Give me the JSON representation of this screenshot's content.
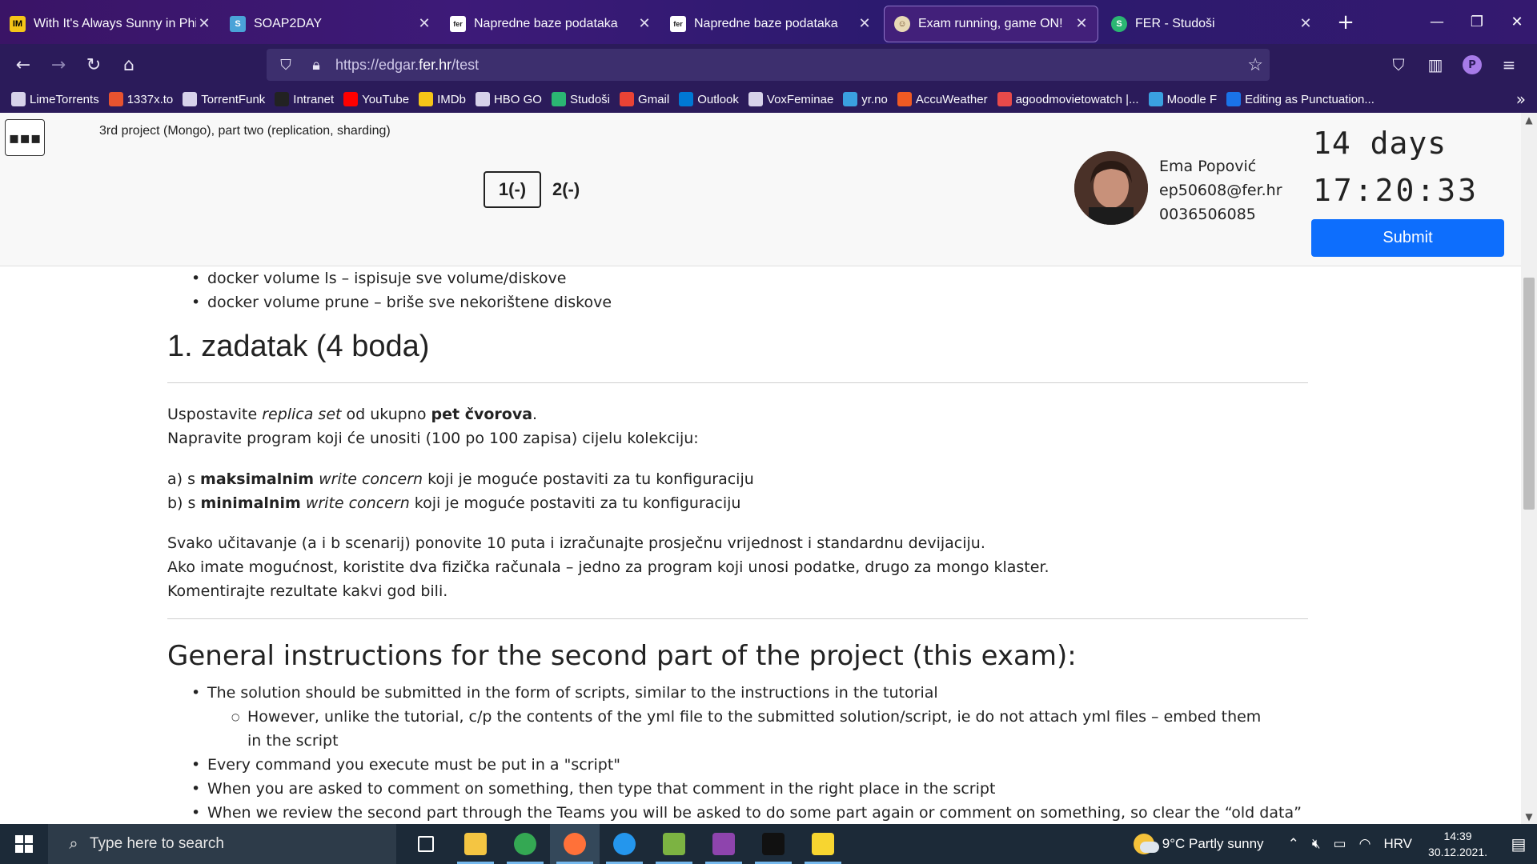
{
  "tabs": [
    {
      "title": "With It's Always Sunny in Philad",
      "favicon": "imdb-icon",
      "color": "#f5c518"
    },
    {
      "title": "SOAP2DAY",
      "favicon": "s-icon",
      "color": "#4aa3d8"
    },
    {
      "title": "Napredne baze podataka",
      "favicon": "fer-icon",
      "color": "#222222"
    },
    {
      "title": "Napredne baze podataka",
      "favicon": "fer-icon",
      "color": "#222222"
    },
    {
      "title": "Exam running, game ON!",
      "favicon": "edgar-icon",
      "color": "#e8d9b5",
      "active": true
    },
    {
      "title": "FER - Studoši",
      "favicon": "studosi-icon",
      "color": "#2bb673"
    }
  ],
  "url": {
    "prefix": "https://edgar.",
    "domain": "fer.hr",
    "path": "/test"
  },
  "bookmarks": [
    {
      "label": "LimeTorrents",
      "icon": "globe-icon",
      "color": "#d7d2ea"
    },
    {
      "label": "1337x.to",
      "icon": "x-icon",
      "color": "#e8532f"
    },
    {
      "label": "TorrentFunk",
      "icon": "torrentfunk-icon",
      "color": "#d7d2ea"
    },
    {
      "label": "Intranet",
      "icon": "fer-icon",
      "color": "#222222"
    },
    {
      "label": "YouTube",
      "icon": "youtube-icon",
      "color": "#ff0000"
    },
    {
      "label": "IMDb",
      "icon": "imdb-icon",
      "color": "#f5c518"
    },
    {
      "label": "HBO GO",
      "icon": "hbo-icon",
      "color": "#d7d2ea"
    },
    {
      "label": "Studoši",
      "icon": "studosi-icon",
      "color": "#2bb673"
    },
    {
      "label": "Gmail",
      "icon": "gmail-icon",
      "color": "#ea4335"
    },
    {
      "label": "Outlook",
      "icon": "outlook-icon",
      "color": "#0078d4"
    },
    {
      "label": "VoxFeminae",
      "icon": "globe-icon",
      "color": "#d7d2ea"
    },
    {
      "label": "yr.no",
      "icon": "yr-icon",
      "color": "#3aa0e0"
    },
    {
      "label": "AccuWeather",
      "icon": "accuweather-icon",
      "color": "#f05a23"
    },
    {
      "label": "agoodmovietowatch |...",
      "icon": "agoodmovie-icon",
      "color": "#e84a4a"
    },
    {
      "label": "Moodle F",
      "icon": "moodle-icon",
      "color": "#3aa0e0"
    },
    {
      "label": "Editing as Punctuation...",
      "icon": "v-icon",
      "color": "#1a73e8"
    }
  ],
  "header": {
    "exam_title": "3rd project (Mongo), part two (replication, sharding)",
    "questions": [
      "1(-)",
      "2(-)"
    ],
    "user": {
      "name": "Ema Popović",
      "email": "ep50608@fer.hr",
      "id": "0036506085"
    },
    "timer_days": "14 days",
    "timer_clock": "17:20:33",
    "submit_label": "Submit"
  },
  "content": {
    "top_items": [
      "docker volume ls – ispisuje sve volume/diskove",
      "docker volume prune – briše sve nekorištene diskove"
    ],
    "task_heading": "1. zadatak (4 boda)",
    "p1_a": "Uspostavite ",
    "p1_b": "replica set",
    "p1_c": " od ukupno ",
    "p1_d": "pet čvorova",
    "p1_e": ".",
    "p2": "Napravite program koji će unositi (100 po 100 zapisa) cijelu kolekciju:",
    "a_pre": "a) s ",
    "a_bold": "maksimalnim",
    "a_it": "write concern",
    "a_post": " koji je moguće postaviti za tu konfiguraciju",
    "b_pre": "b) s ",
    "b_bold": "minimalnim",
    "b_it": "write concern",
    "b_post": " koji je moguće postaviti za tu konfiguraciju",
    "p3": "Svako učitavanje (a i b scenarij) ponovite 10 puta i izračunajte prosječnu vrijednost i standardnu devijaciju.",
    "p4": "Ako imate mogućnost, koristite dva fizička računala – jedno za program koji unosi podatke, drugo za mongo klaster.",
    "p5": "Komentirajte rezultate kakvi god bili.",
    "general_heading": "General instructions for the second part of the project (this exam):",
    "gi1": "The solution should be submitted in the form of scripts, similar to the instructions in the tutorial",
    "gi1_sub": "However, unlike the tutorial, c/p the contents of the yml file to the submitted solution/script, ie do not attach yml files – embed them in the script",
    "gi2": "Every command you execute must be put in a \"script\"",
    "gi3": "When you are asked to comment on something, then type that comment in the right place in the script",
    "gi4": "When we review the second part through the Teams you will be asked to do some part again or comment on something, so clear the “old data” and"
  },
  "taskbar": {
    "search_placeholder": "Type here to search",
    "apps": [
      {
        "name": "task-view-icon",
        "color": "#ffffff"
      },
      {
        "name": "file-explorer-icon",
        "color": "#f4c542"
      },
      {
        "name": "chrome-icon",
        "color": "#34a853"
      },
      {
        "name": "firefox-icon",
        "color": "#ff7139"
      },
      {
        "name": "docker-icon",
        "color": "#2496ed"
      },
      {
        "name": "notepad-icon",
        "color": "#7cb342"
      },
      {
        "name": "winrar-icon",
        "color": "#8e44ad"
      },
      {
        "name": "terminal-icon",
        "color": "#111111"
      },
      {
        "name": "sticky-notes-icon",
        "color": "#f7d530"
      }
    ],
    "weather": "9°C  Partly sunny",
    "lang": "HRV",
    "time": "14:39",
    "date": "30.12.2021."
  }
}
